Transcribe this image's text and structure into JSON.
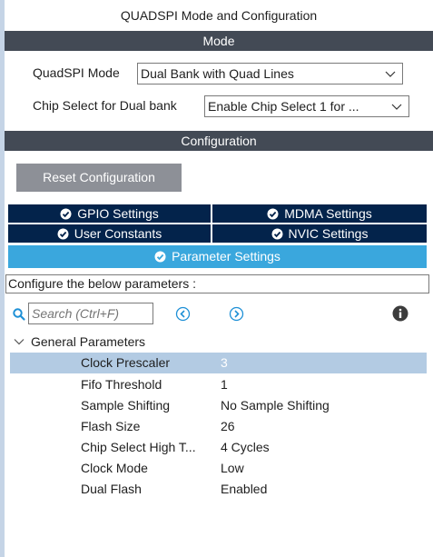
{
  "title": "QUADSPI Mode and Configuration",
  "mode": {
    "header": "Mode",
    "quadspi_mode_label": "QuadSPI Mode",
    "quadspi_mode_value": "Dual Bank with Quad Lines",
    "chip_select_label": "Chip Select for Dual bank",
    "chip_select_value": "Enable Chip Select 1 for ..."
  },
  "configuration": {
    "header": "Configuration",
    "reset_button": "Reset Configuration",
    "tabs": [
      {
        "label": "GPIO Settings",
        "active": false
      },
      {
        "label": "MDMA Settings",
        "active": false
      },
      {
        "label": "User Constants",
        "active": false
      },
      {
        "label": "NVIC Settings",
        "active": false
      },
      {
        "label": "Parameter Settings",
        "active": true
      }
    ]
  },
  "parameters": {
    "instruction": "Configure the below parameters :",
    "search_placeholder": "Search (Ctrl+F)",
    "group_label": "General Parameters",
    "rows": [
      {
        "name": "Clock Prescaler",
        "value": "3",
        "selected": true
      },
      {
        "name": "Fifo Threshold",
        "value": "1",
        "selected": false
      },
      {
        "name": "Sample Shifting",
        "value": "No Sample Shifting",
        "selected": false
      },
      {
        "name": "Flash Size",
        "value": "26",
        "selected": false
      },
      {
        "name": "Chip Select High T...",
        "value": "4 Cycles",
        "selected": false
      },
      {
        "name": "Clock Mode",
        "value": "Low",
        "selected": false
      },
      {
        "name": "Dual Flash",
        "value": "Enabled",
        "selected": false
      }
    ]
  },
  "colors": {
    "section_header": "#434a55",
    "tab_inactive": "#03234b",
    "tab_active": "#3aa7dd",
    "selected_row": "#b3cbe3",
    "nav_icon": "#1e90d6"
  },
  "icons": [
    "search-icon",
    "arrow-left-circle-icon",
    "arrow-right-circle-icon",
    "info-icon",
    "check-circle-icon",
    "chevron-down-icon"
  ]
}
